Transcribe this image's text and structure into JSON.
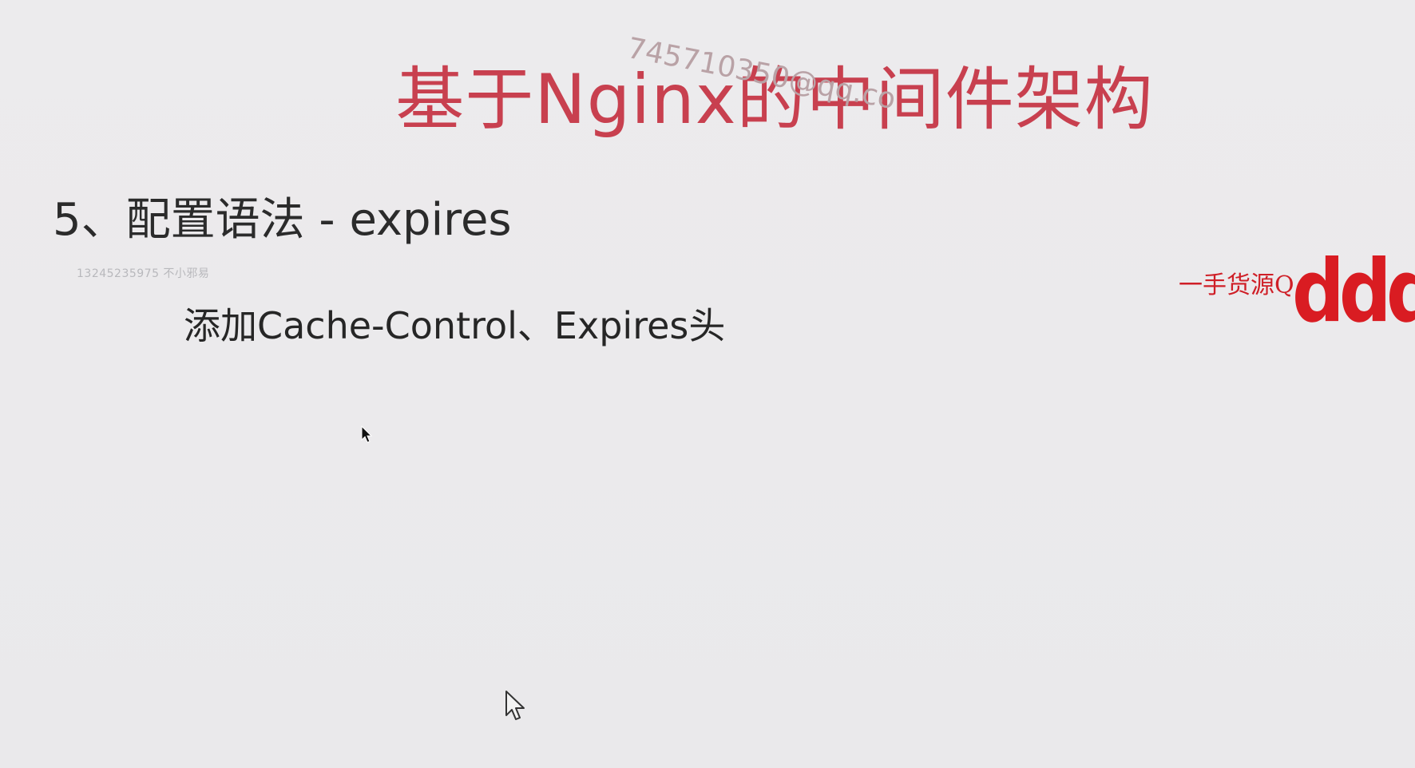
{
  "slide": {
    "title": "基于Nginx的中间件架构",
    "section_heading": "5、配置语法 - expires",
    "bullet": "添加Cache-Control、Expires头"
  },
  "watermarks": {
    "email": "745710350@qq.co",
    "small_contact": "13245235975 不小邪易",
    "vendor_text": "一手货源Q",
    "vendor_logo": "dddd"
  },
  "icons": {
    "cursor_small": "arrow-cursor-icon",
    "cursor_outline": "pointer-cursor-icon"
  },
  "colors": {
    "title": "#c8404f",
    "background": "#ebeaec",
    "vendor": "#d91c22"
  }
}
